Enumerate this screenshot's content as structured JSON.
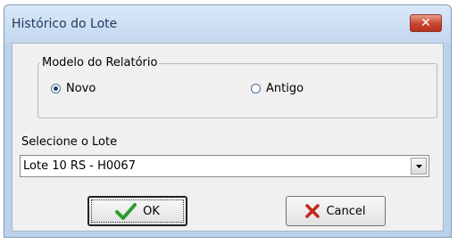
{
  "window": {
    "title": "Histórico do Lote",
    "close_icon": "close-icon"
  },
  "report_model": {
    "legend": "Modelo do Relatório",
    "options": [
      {
        "label": "Novo",
        "checked": true
      },
      {
        "label": "Antigo",
        "checked": false
      }
    ]
  },
  "lote": {
    "label": "Selecione o Lote",
    "selected": "Lote 10 RS - H0067"
  },
  "buttons": {
    "ok_label": "OK",
    "ok_icon": "checkmark-icon",
    "cancel_label": "Cancel",
    "cancel_icon": "x-icon"
  },
  "colors": {
    "title_bar": "#c3d7ee",
    "close_button": "#c6452f",
    "ok_check": "#2e9a2e",
    "cancel_x": "#c0281c"
  }
}
